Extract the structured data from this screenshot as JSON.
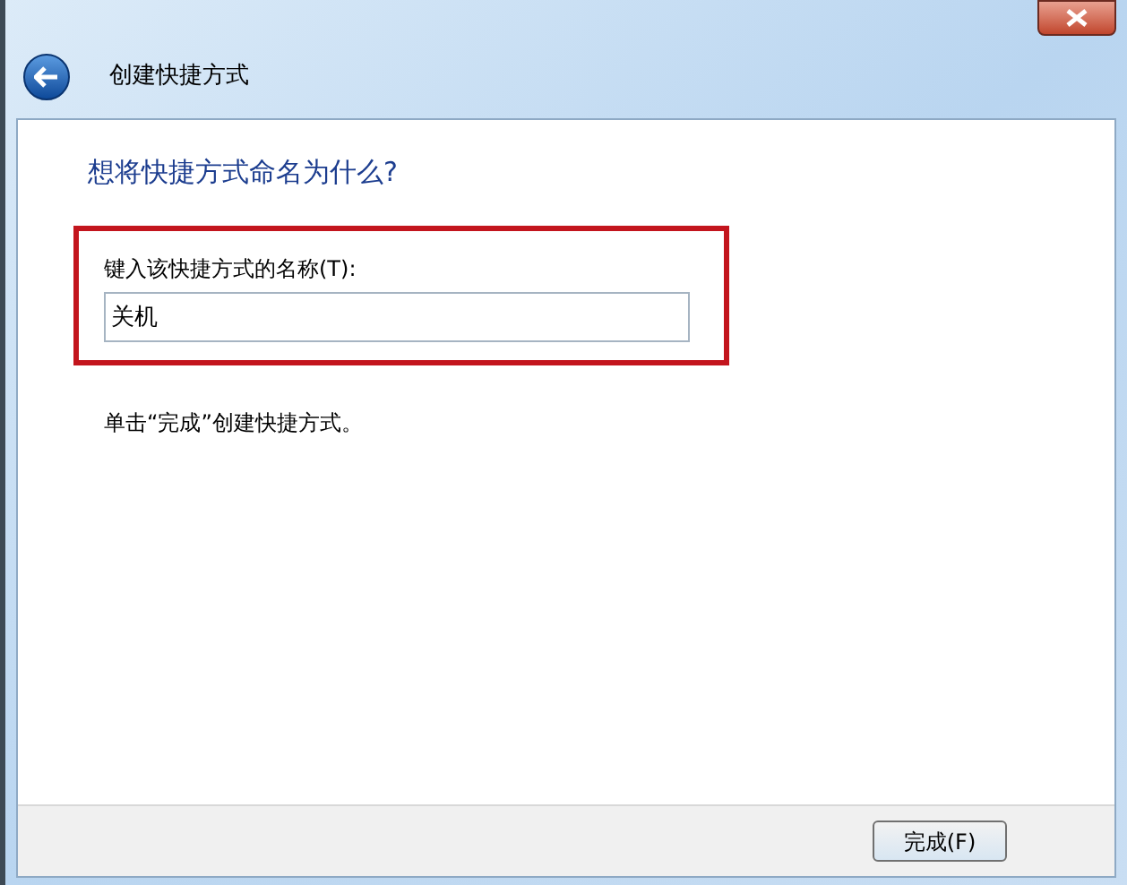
{
  "window": {
    "title": "创建快捷方式"
  },
  "heading": "想将快捷方式命名为什么?",
  "name_field": {
    "label": "键入该快捷方式的名称(T):",
    "value": "关机"
  },
  "hint": "单击“完成”创建快捷方式。",
  "buttons": [
    {
      "label": "完成(F)"
    }
  ]
}
